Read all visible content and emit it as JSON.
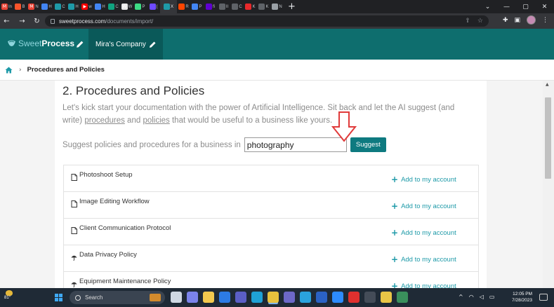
{
  "browser": {
    "tabs": [
      {
        "icon": "gmail-icon",
        "color": "#ea4335",
        "glyph": "M",
        "label": "In"
      },
      {
        "icon": "brave-icon",
        "color": "#fb542b",
        "glyph": "",
        "label": "B"
      },
      {
        "icon": "gmail-icon",
        "color": "#ea4335",
        "glyph": "M",
        "label": "N"
      },
      {
        "icon": "docs-icon",
        "color": "#4285f4",
        "glyph": "",
        "label": "H"
      },
      {
        "icon": "sweetprocess-icon",
        "color": "#1e9aa8",
        "glyph": "",
        "label": "C"
      },
      {
        "icon": "sweetprocess-icon",
        "color": "#1e9aa8",
        "glyph": "",
        "label": "H"
      },
      {
        "icon": "youtube-icon",
        "color": "#ff0000",
        "glyph": "▶",
        "label": "w"
      },
      {
        "icon": "docs-icon",
        "color": "#4285f4",
        "glyph": "",
        "label": "H"
      },
      {
        "icon": "chatgpt-icon",
        "color": "#10a37f",
        "glyph": "",
        "label": "C"
      },
      {
        "icon": "wordpress-icon",
        "color": "#e8e8e8",
        "glyph": "W",
        "label": "W"
      },
      {
        "icon": "android-icon",
        "color": "#3ddc84",
        "glyph": "",
        "label": "P"
      },
      {
        "icon": "proton-icon",
        "color": "#6d4aff",
        "glyph": "",
        "label": "("
      },
      {
        "icon": "sweetprocess-icon",
        "color": "#1e9aa8",
        "glyph": "",
        "label": "X",
        "active": true
      },
      {
        "icon": "reddit-icon",
        "color": "#ff4500",
        "glyph": "",
        "label": "R"
      },
      {
        "icon": "docs-icon",
        "color": "#4285f4",
        "glyph": "",
        "label": "P"
      },
      {
        "icon": "yahoo-icon",
        "color": "#6001d2",
        "glyph": "",
        "label": "fi"
      },
      {
        "icon": "loop-icon",
        "color": "#5f6368",
        "glyph": "",
        "label": "II"
      },
      {
        "icon": "loop-icon",
        "color": "#5f6368",
        "glyph": "",
        "label": "C"
      },
      {
        "icon": "acrobat-icon",
        "color": "#e8292b",
        "glyph": "",
        "label": "K"
      },
      {
        "icon": "loop-icon",
        "color": "#5f6368",
        "glyph": "",
        "label": "K"
      },
      {
        "icon": "globe-icon",
        "color": "#9aa0a6",
        "glyph": "",
        "label": "N"
      }
    ],
    "new_tab": "+",
    "window_controls": {
      "chevron": "⌄",
      "minimize": "—",
      "maximize": "▢",
      "close": "✕"
    },
    "nav": {
      "back": "←",
      "forward": "→",
      "reload": "↻"
    },
    "url_host": "sweetprocess.com",
    "url_path": "/documents/import/"
  },
  "app": {
    "logo_sweet": "Sweet",
    "logo_process": "Process",
    "company_name": "Mira's Company",
    "brand_color": "#0e6e6e"
  },
  "breadcrumb": {
    "separator": "›",
    "current": "Procedures and Policies"
  },
  "page": {
    "title": "2. Procedures and Policies",
    "intro_before": "Let's kick start your documentation with the power of Artificial Intelligence. Sit back and let the AI suggest (and write) ",
    "intro_link1": "procedures",
    "intro_and": " and ",
    "intro_link2": "policies",
    "intro_after": " that would be useful to a business like yours.",
    "suggest_label": "Suggest policies and procedures for a business in",
    "business_value": "photography",
    "suggest_button": "Suggest",
    "add_label": "Add to my account",
    "items": [
      {
        "type": "procedure",
        "icon": "document-icon",
        "label": "Photoshoot Setup"
      },
      {
        "type": "procedure",
        "icon": "document-icon",
        "label": "Image Editing Workflow"
      },
      {
        "type": "procedure",
        "icon": "document-icon",
        "label": "Client Communication Protocol"
      },
      {
        "type": "policy",
        "icon": "umbrella-icon",
        "label": "Data Privacy Policy"
      },
      {
        "type": "policy",
        "icon": "umbrella-icon",
        "label": "Equipment Maintenance Policy"
      }
    ]
  },
  "taskbar": {
    "temperature": "81°",
    "search_label": "Search",
    "time": "12:05 PM",
    "date": "7/28/2023",
    "apps": [
      {
        "icon": "task-view-icon",
        "color": "#cfd8e3"
      },
      {
        "icon": "teams-chat-icon",
        "color": "#7b83eb"
      },
      {
        "icon": "file-explorer-icon",
        "color": "#f3c94e"
      },
      {
        "icon": "mail-icon",
        "color": "#2c7be5"
      },
      {
        "icon": "teams-icon",
        "color": "#5b5fc7"
      },
      {
        "icon": "edge-icon",
        "color": "#1fa1d6"
      },
      {
        "icon": "chrome-icon",
        "color": "#e7c13d",
        "active": true
      },
      {
        "icon": "media-icon",
        "color": "#6d68c8"
      },
      {
        "icon": "telegram-icon",
        "color": "#2aa3de"
      },
      {
        "icon": "word-icon",
        "color": "#2b62c4"
      },
      {
        "icon": "zoom-icon",
        "color": "#2d8cff"
      },
      {
        "icon": "acrobat-icon",
        "color": "#e0302e"
      },
      {
        "icon": "app-icon",
        "color": "#444c58"
      },
      {
        "icon": "files-icon",
        "color": "#e9c546"
      },
      {
        "icon": "vpn-icon",
        "color": "#3a8f5c"
      }
    ],
    "tray": {
      "chevron": "^",
      "wifi": "◠",
      "volume": "◁",
      "battery": "▭"
    }
  }
}
